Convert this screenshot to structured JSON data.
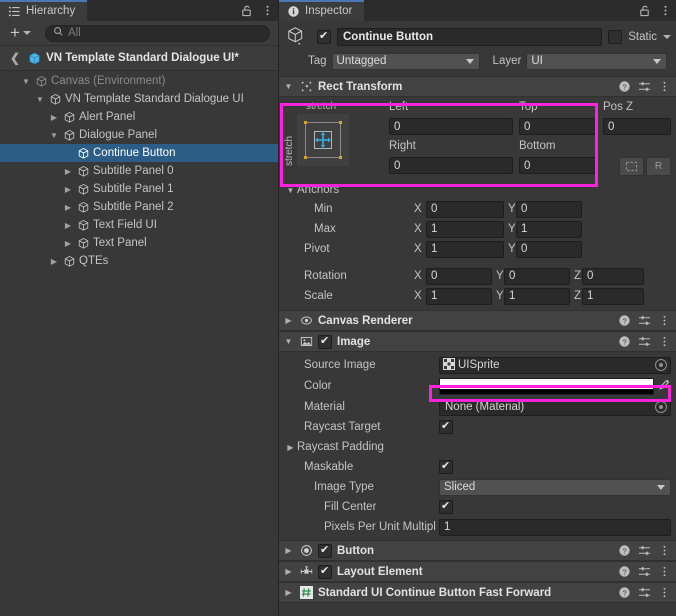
{
  "hierarchy": {
    "tab_label": "Hierarchy",
    "tab_icon": "hierarchy-list-icon",
    "lock_icon": "lock-open-icon",
    "menu_icon": "kebab-menu-icon",
    "toolbar": {
      "add_label": "+",
      "add_dropdown_icon": "chevron-down-icon",
      "search_icon": "search-icon",
      "search_placeholder": "All",
      "search_value": ""
    },
    "scene_root": {
      "back_icon": "chevron-left-icon",
      "label": "VN Template Standard Dialogue UI*",
      "icon": "prefab-cube-icon"
    },
    "items": [
      {
        "label": "Canvas (Environment)",
        "depth": 1,
        "arrow": "down",
        "dim": true,
        "selected": false,
        "icon": "gameobject-cube-icon"
      },
      {
        "label": "VN Template Standard Dialogue UI",
        "depth": 2,
        "arrow": "down",
        "dim": false,
        "selected": false,
        "icon": "gameobject-cube-icon"
      },
      {
        "label": "Alert Panel",
        "depth": 3,
        "arrow": "right",
        "dim": false,
        "selected": false,
        "icon": "gameobject-cube-icon"
      },
      {
        "label": "Dialogue Panel",
        "depth": 3,
        "arrow": "down",
        "dim": false,
        "selected": false,
        "icon": "gameobject-cube-icon"
      },
      {
        "label": "Continue Button",
        "depth": 4,
        "arrow": "none",
        "dim": false,
        "selected": true,
        "icon": "gameobject-cube-icon"
      },
      {
        "label": "Subtitle Panel 0",
        "depth": 4,
        "arrow": "right",
        "dim": false,
        "selected": false,
        "icon": "gameobject-cube-icon"
      },
      {
        "label": "Subtitle Panel 1",
        "depth": 4,
        "arrow": "right",
        "dim": false,
        "selected": false,
        "icon": "gameobject-cube-icon"
      },
      {
        "label": "Subtitle Panel 2",
        "depth": 4,
        "arrow": "right",
        "dim": false,
        "selected": false,
        "icon": "gameobject-cube-icon"
      },
      {
        "label": "Text Field UI",
        "depth": 4,
        "arrow": "right",
        "dim": false,
        "selected": false,
        "icon": "gameobject-cube-icon"
      },
      {
        "label": "Text Panel",
        "depth": 4,
        "arrow": "right",
        "dim": false,
        "selected": false,
        "icon": "gameobject-cube-icon"
      },
      {
        "label": "QTEs",
        "depth": 3,
        "arrow": "right",
        "dim": false,
        "selected": false,
        "icon": "gameobject-cube-icon"
      }
    ]
  },
  "inspector": {
    "tab_label": "Inspector",
    "tab_icon": "info-circle-icon",
    "lock_icon": "lock-open-icon",
    "menu_icon": "kebab-menu-icon",
    "object": {
      "icon": "gameobject-cube-icon",
      "enabled": true,
      "name": "Continue Button",
      "static_label": "Static",
      "static_checked": false,
      "static_dropdown_icon": "chevron-down-icon",
      "tag_label": "Tag",
      "tag_value": "Untagged",
      "layer_label": "Layer",
      "layer_value": "UI"
    },
    "components": [
      {
        "name": "Rect Transform",
        "icon": "rect-transform-icon",
        "foldout": "down",
        "has_enable_checkbox": false,
        "help_icon": "help-icon",
        "preset_icon": "preset-slider-icon",
        "menu_icon": "kebab-menu-icon"
      },
      {
        "name": "Canvas Renderer",
        "icon": "canvas-renderer-eye-icon",
        "foldout": "right",
        "has_enable_checkbox": false,
        "help_icon": "help-icon",
        "preset_icon": "preset-slider-icon",
        "menu_icon": "kebab-menu-icon"
      },
      {
        "name": "Image",
        "icon": "image-component-icon",
        "foldout": "down",
        "has_enable_checkbox": true,
        "enabled": true,
        "help_icon": "help-icon",
        "preset_icon": "preset-slider-icon",
        "menu_icon": "kebab-menu-icon"
      },
      {
        "name": "Button",
        "icon": "button-component-icon",
        "foldout": "right",
        "has_enable_checkbox": true,
        "enabled": true,
        "help_icon": "help-icon",
        "preset_icon": "preset-slider-icon",
        "menu_icon": "kebab-menu-icon"
      },
      {
        "name": "Layout Element",
        "icon": "layout-element-icon",
        "foldout": "right",
        "has_enable_checkbox": true,
        "enabled": true,
        "help_icon": "help-icon",
        "preset_icon": "preset-slider-icon",
        "menu_icon": "kebab-menu-icon"
      },
      {
        "name": "Standard UI Continue Button Fast Forward",
        "icon": "script-hash-icon",
        "foldout": "right",
        "has_enable_checkbox": false,
        "help_icon": "help-icon",
        "preset_icon": "preset-slider-icon",
        "menu_icon": "kebab-menu-icon"
      }
    ],
    "rect_transform": {
      "anchor_preset_top_label": "stretch",
      "anchor_preset_side_label": "stretch",
      "left_label": "Left",
      "left_value": "0",
      "top_label": "Top",
      "top_value": "0",
      "right_label": "Right",
      "right_value": "0",
      "bottom_label": "Bottom",
      "bottom_value": "0",
      "posz_label": "Pos Z",
      "posz_value": "0",
      "blueprint_icon": "blueprint-mode-icon",
      "raw_label": "R",
      "anchors_label": "Anchors",
      "anchors_foldout": "down",
      "min_label": "Min",
      "min_x": "0",
      "min_y": "0",
      "max_label": "Max",
      "max_x": "1",
      "max_y": "1",
      "pivot_label": "Pivot",
      "pivot_x": "1",
      "pivot_y": "0",
      "rotation_label": "Rotation",
      "rotation_x": "0",
      "rotation_y": "0",
      "rotation_z": "0",
      "scale_label": "Scale",
      "scale_x": "1",
      "scale_y": "1",
      "scale_z": "1",
      "axis_x": "X",
      "axis_y": "Y",
      "axis_z": "Z"
    },
    "image": {
      "source_image_label": "Source Image",
      "source_image_value": "UISprite",
      "source_image_icon": "sprite-icon",
      "color_label": "Color",
      "color_value": "#FFFFFF",
      "color_alpha_bar": "#000000",
      "eyedropper_icon": "eyedropper-icon",
      "material_label": "Material",
      "material_value": "None (Material)",
      "raycast_target_label": "Raycast Target",
      "raycast_target_checked": true,
      "raycast_padding_label": "Raycast Padding",
      "raycast_padding_foldout": "right",
      "maskable_label": "Maskable",
      "maskable_checked": true,
      "image_type_label": "Image Type",
      "image_type_value": "Sliced",
      "fill_center_label": "Fill Center",
      "fill_center_checked": true,
      "ppum_label": "Pixels Per Unit Multipl",
      "ppum_value": "1"
    },
    "highlight_color": "#ff22dd"
  }
}
